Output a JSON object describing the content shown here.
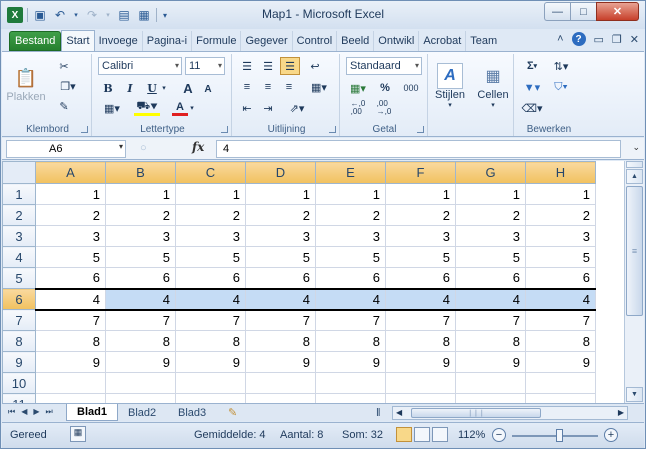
{
  "window": {
    "title": "Map1 - Microsoft Excel"
  },
  "qat": {
    "save": "save-icon",
    "undo": "undo-icon",
    "redo": "redo-icon"
  },
  "tabs": [
    "Start",
    "Invoege",
    "Pagina-i",
    "Formule",
    "Gegever",
    "Control",
    "Beeld",
    "Ontwikl",
    "Acrobat",
    "Team"
  ],
  "file_tab": "Bestand",
  "ribbon": {
    "clipboard": {
      "paste": "Plakken",
      "label": "Klembord"
    },
    "font": {
      "name": "Calibri",
      "size": "11",
      "bold": "B",
      "italic": "I",
      "underline": "U",
      "grow": "A",
      "shrink": "A",
      "color": "A",
      "label": "Lettertype"
    },
    "alignment": {
      "label": "Uitlijning"
    },
    "number": {
      "format": "Standaard",
      "percent": "%",
      "thousands": "000",
      "label": "Getal",
      "inc_dec": ",0 ,00"
    },
    "styles": {
      "label": "Stijlen"
    },
    "cells": {
      "label": "Cellen"
    },
    "editing": {
      "label": "Bewerken",
      "sum": "Σ"
    }
  },
  "formula_bar": {
    "name_box": "A6",
    "fx": "fx",
    "value": "4"
  },
  "grid": {
    "columns": [
      "A",
      "B",
      "C",
      "D",
      "E",
      "F",
      "G",
      "H"
    ],
    "rows": [
      {
        "n": "1",
        "v": [
          "1",
          "1",
          "1",
          "1",
          "1",
          "1",
          "1",
          "1"
        ]
      },
      {
        "n": "2",
        "v": [
          "2",
          "2",
          "2",
          "2",
          "2",
          "2",
          "2",
          "2"
        ]
      },
      {
        "n": "3",
        "v": [
          "3",
          "3",
          "3",
          "3",
          "3",
          "3",
          "3",
          "3"
        ]
      },
      {
        "n": "4",
        "v": [
          "5",
          "5",
          "5",
          "5",
          "5",
          "5",
          "5",
          "5"
        ]
      },
      {
        "n": "5",
        "v": [
          "6",
          "6",
          "6",
          "6",
          "6",
          "6",
          "6",
          "6"
        ]
      },
      {
        "n": "6",
        "v": [
          "4",
          "4",
          "4",
          "4",
          "4",
          "4",
          "4",
          "4"
        ]
      },
      {
        "n": "7",
        "v": [
          "7",
          "7",
          "7",
          "7",
          "7",
          "7",
          "7",
          "7"
        ]
      },
      {
        "n": "8",
        "v": [
          "8",
          "8",
          "8",
          "8",
          "8",
          "8",
          "8",
          "8"
        ]
      },
      {
        "n": "9",
        "v": [
          "9",
          "9",
          "9",
          "9",
          "9",
          "9",
          "9",
          "9"
        ]
      },
      {
        "n": "10",
        "v": [
          "",
          "",
          "",
          "",
          "",
          "",
          "",
          ""
        ]
      },
      {
        "n": "11",
        "v": [
          "",
          "",
          "",
          "",
          "",
          "",
          "",
          ""
        ]
      }
    ],
    "selected_row": "6"
  },
  "sheets": [
    "Blad1",
    "Blad2",
    "Blad3"
  ],
  "status": {
    "ready": "Gereed",
    "average": "Gemiddelde: 4",
    "count": "Aantal: 8",
    "sum": "Som: 32",
    "zoom": "112%"
  },
  "colors": {
    "accent": "#f1c15f",
    "file_tab": "#26802f",
    "selection": "#c5dcf5"
  }
}
